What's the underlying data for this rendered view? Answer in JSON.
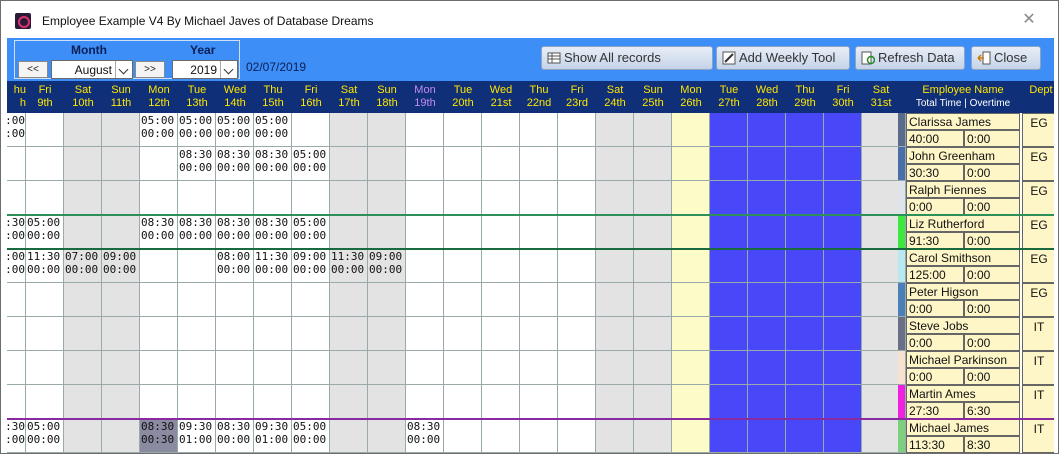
{
  "window": {
    "title": "Employee Example V4 By Michael Javes of Database Dreams"
  },
  "nav": {
    "month_label": "Month",
    "year_label": "Year",
    "prev": "<<",
    "next": ">>",
    "month_value": "August",
    "year_value": "2019",
    "date": "02/07/2019"
  },
  "toolbar": {
    "show_all": "Show All records",
    "add_weekly": "Add Weekly Tool",
    "refresh": "Refresh Data",
    "close": "Close"
  },
  "days": [
    {
      "d": "hu",
      "n": "h"
    },
    {
      "d": "Fri",
      "n": "9th"
    },
    {
      "d": "Sat",
      "n": "10th"
    },
    {
      "d": "Sun",
      "n": "11th"
    },
    {
      "d": "Mon",
      "n": "12th"
    },
    {
      "d": "Tue",
      "n": "13th"
    },
    {
      "d": "Wed",
      "n": "14th"
    },
    {
      "d": "Thu",
      "n": "15th"
    },
    {
      "d": "Fri",
      "n": "16th"
    },
    {
      "d": "Sat",
      "n": "17th"
    },
    {
      "d": "Sun",
      "n": "18th"
    },
    {
      "d": "Mon",
      "n": "19th",
      "hl": true
    },
    {
      "d": "Tue",
      "n": "20th"
    },
    {
      "d": "Wed",
      "n": "21st"
    },
    {
      "d": "Thu",
      "n": "22nd"
    },
    {
      "d": "Fri",
      "n": "23rd"
    },
    {
      "d": "Sat",
      "n": "24th"
    },
    {
      "d": "Sun",
      "n": "25th"
    },
    {
      "d": "Mon",
      "n": "26th"
    },
    {
      "d": "Tue",
      "n": "27th"
    },
    {
      "d": "Wed",
      "n": "28th"
    },
    {
      "d": "Thu",
      "n": "29th"
    },
    {
      "d": "Fri",
      "n": "30th"
    },
    {
      "d": "Sat",
      "n": "31st"
    }
  ],
  "header": {
    "emp_name": "Employee Name",
    "emp_sub": "Total Time | Overtime",
    "dept": "Dept"
  },
  "employees": [
    {
      "name": "Clarissa James",
      "total": "40:00",
      "overtime": "0:00",
      "dept": "EG",
      "color": "#5a6a8a",
      "cells": {
        "0": [
          ":00",
          ":00"
        ],
        "4": [
          "05:00",
          "00:00"
        ],
        "5": [
          "05:00",
          "00:00"
        ],
        "6": [
          "05:00",
          "00:00"
        ],
        "7": [
          "05:00",
          "00:00"
        ]
      }
    },
    {
      "name": "John Greenham",
      "total": "30:30",
      "overtime": "0:00",
      "dept": "EG",
      "color": "#4a6fa8",
      "cells": {
        "5": [
          "08:30",
          "00:00"
        ],
        "6": [
          "08:30",
          "00:00"
        ],
        "7": [
          "08:30",
          "00:00"
        ],
        "8": [
          "05:00",
          "00:00"
        ]
      }
    },
    {
      "name": "Ralph Fiennes",
      "total": "0:00",
      "overtime": "0:00",
      "dept": "EG",
      "color": "#dfe3ea",
      "cells": {}
    },
    {
      "name": "Liz Rutherford",
      "total": "91:30",
      "overtime": "0:00",
      "dept": "EG",
      "color": "#3ce83c",
      "cells": {
        "0": [
          ":30",
          ":00"
        ],
        "1": [
          "05:00",
          "00:00"
        ],
        "4": [
          "08:30",
          "00:00"
        ],
        "5": [
          "08:30",
          "00:00"
        ],
        "6": [
          "08:30",
          "00:00"
        ],
        "7": [
          "08:30",
          "00:00"
        ],
        "8": [
          "05:00",
          "00:00"
        ]
      }
    },
    {
      "name": "Carol Smithson",
      "total": "125:00",
      "overtime": "0:00",
      "dept": "EG",
      "color": "#b8e8f0",
      "cells": {
        "0": [
          ":00",
          ":00"
        ],
        "1": [
          "11:30",
          "00:00"
        ],
        "2": [
          "07:00",
          "00:00"
        ],
        "3": [
          "09:00",
          "00:00"
        ],
        "6": [
          "08:00",
          "00:00"
        ],
        "7": [
          "11:30",
          "00:00"
        ],
        "8": [
          "09:00",
          "00:00"
        ],
        "9": [
          "11:30",
          "00:00"
        ],
        "10": [
          "09:00",
          "00:00"
        ]
      }
    },
    {
      "name": "Peter Higson",
      "total": "0:00",
      "overtime": "0:00",
      "dept": "EG",
      "color": "#4a7fb8",
      "cells": {}
    },
    {
      "name": "Steve Jobs",
      "total": "0:00",
      "overtime": "0:00",
      "dept": "IT",
      "color": "#6a6f88",
      "cells": {}
    },
    {
      "name": "Michael Parkinson",
      "total": "0:00",
      "overtime": "0:00",
      "dept": "IT",
      "color": "#f8e0d0",
      "cells": {}
    },
    {
      "name": "Martin Ames",
      "total": "27:30",
      "overtime": "6:30",
      "dept": "IT",
      "color": "#f020e0",
      "cells": {}
    },
    {
      "name": "Michael James",
      "total": "113:30",
      "overtime": "8:30",
      "dept": "IT",
      "color": "#7ccf7c",
      "cells": {
        "0": [
          ":30",
          ":00"
        ],
        "1": [
          "05:00",
          "00:00"
        ],
        "4": [
          "08:30",
          "00:30"
        ],
        "5": [
          "09:30",
          "01:00"
        ],
        "6": [
          "08:30",
          "00:00"
        ],
        "7": [
          "09:30",
          "01:00"
        ],
        "8": [
          "05:00",
          "00:00"
        ],
        "11": [
          "08:30",
          "00:00"
        ]
      }
    }
  ],
  "colors": {
    "weekend": "#e3e3e3",
    "monday_col": "#fdfbc8",
    "blue_block": "#4848f8",
    "header_bg": "#0f2f78",
    "toolbar_bg": "#3d8ef7"
  },
  "icons": {
    "app": "app-logo-icon",
    "close": "close-icon",
    "show_all": "table-icon",
    "add_weekly": "tool-icon",
    "refresh": "refresh-icon",
    "close_btn": "exit-icon"
  }
}
